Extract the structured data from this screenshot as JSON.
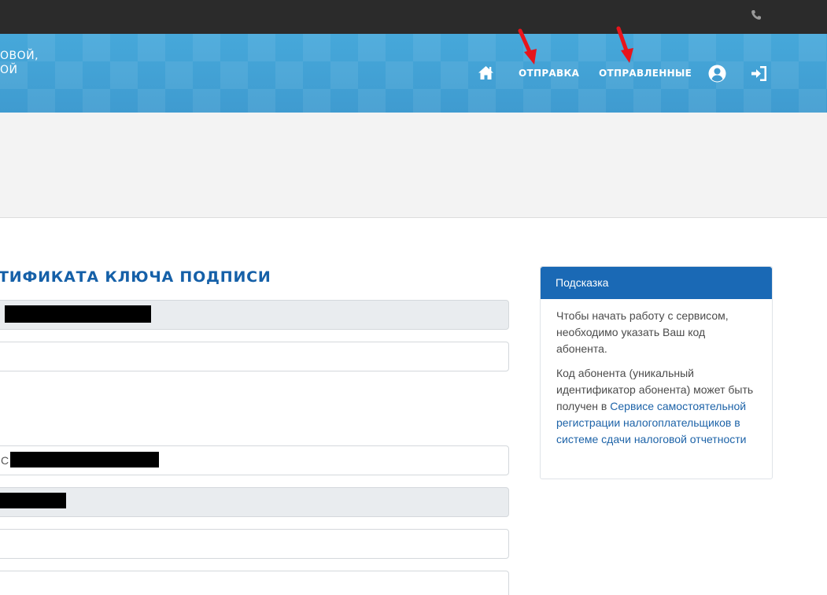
{
  "header": {
    "brand_line1": "ОВОЙ,",
    "brand_line2": "ОЙ",
    "nav": {
      "home_icon": "home-icon",
      "send": "ОТПРАВКА",
      "sent": "ОТПРАВЛЕННЫЕ",
      "user_icon": "user-circle-icon",
      "exit_icon": "sign-out-icon"
    }
  },
  "topbar": {
    "phone_icon": "phone-icon"
  },
  "form": {
    "title": "ТИФИКАТА КЛЮЧА ПОДПИСИ",
    "field3_prefix": "С"
  },
  "hint": {
    "title": "Подсказка",
    "p1": "Чтобы начать работу с сервисом, необходимо указать Ваш код абонента.",
    "p2_text": "Код абонента (уникальный идентификатор абонента) может быть получен в ",
    "p2_link": "Сервисе самостоятельной регистрации налогоплательщиков в системе сдачи налоговой отчетности"
  },
  "colors": {
    "topbar": "#2b2b2b",
    "header": "#4aa3d6",
    "title": "#1560a8",
    "hint_header": "#1a69b5",
    "link": "#1d63a8",
    "arrow": "#e8141b"
  }
}
